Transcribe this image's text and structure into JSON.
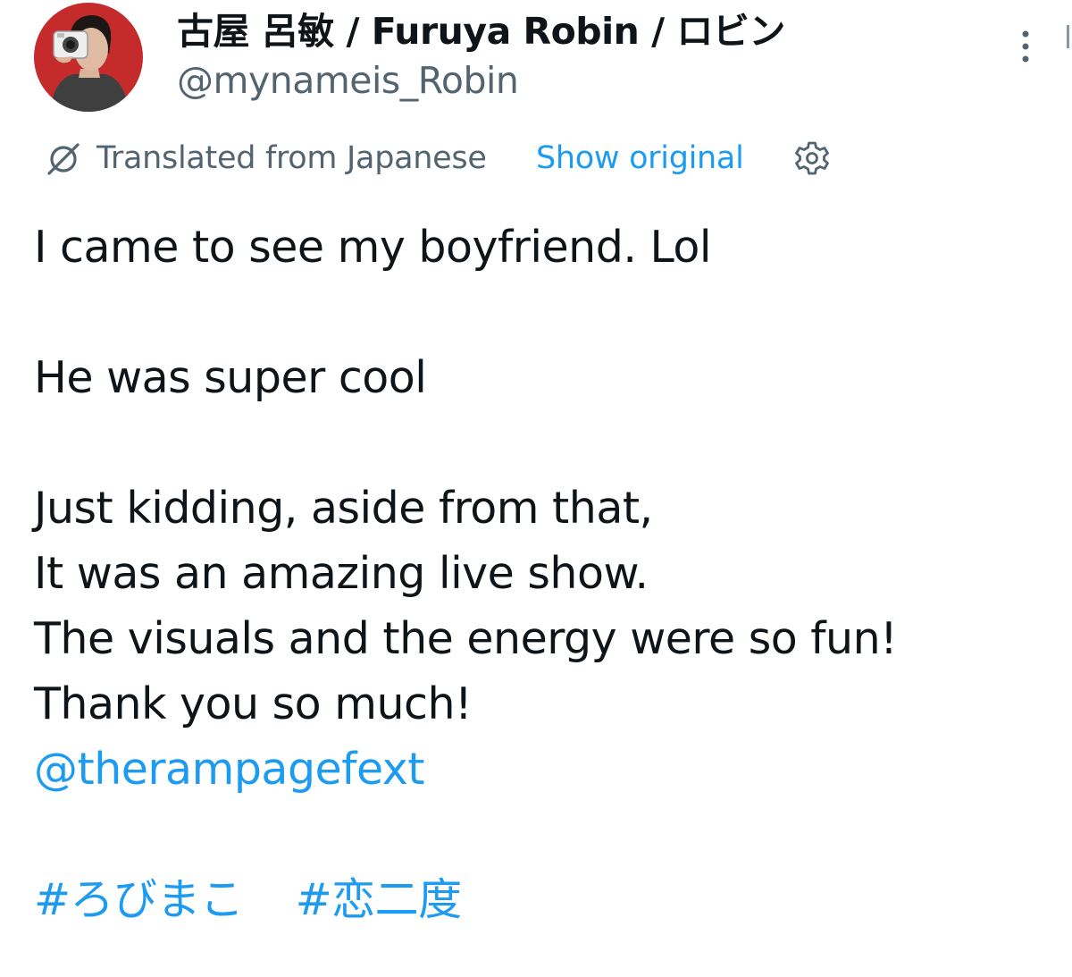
{
  "tweet": {
    "author": {
      "display_name": "古屋 呂敏 / Furuya Robin / ロビン",
      "handle": "@mynameis_Robin",
      "avatar_icon": "profile-photo-person-with-camera"
    },
    "translation_bar": {
      "translated_label": "Translated from Japanese",
      "show_original_label": "Show original",
      "translate_icon": "translate-icon",
      "settings_icon": "gear-icon"
    },
    "body": {
      "line_1": "I came to see my boyfriend. Lol",
      "line_2": "He was super cool",
      "line_3": "Just kidding, aside from that,",
      "line_4": "It was an amazing live show.",
      "line_5": "The visuals and the energy were so fun!",
      "line_6": "Thank you so much!",
      "mention": "@therampagefext",
      "hashtags": [
        "#ろびまこ",
        "#恋二度"
      ]
    },
    "more_icon": "more-vertical-icon"
  },
  "colors": {
    "text_primary": "#0f1419",
    "text_secondary": "#536471",
    "link": "#1d9bf0",
    "avatar_background": "#c62b2b"
  }
}
